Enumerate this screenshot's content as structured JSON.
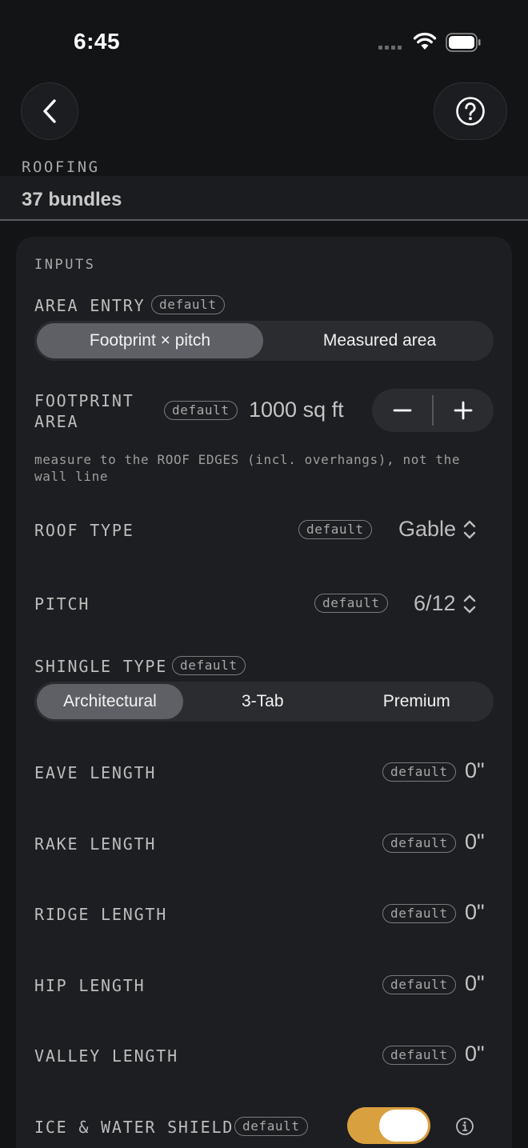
{
  "status": {
    "time": "6:45"
  },
  "header": {
    "section": "ROOFING",
    "result": "37 bundles"
  },
  "card": {
    "title": "INPUTS",
    "badge": "default",
    "area_entry": {
      "label": "AREA ENTRY",
      "options": [
        "Footprint × pitch",
        "Measured area"
      ],
      "selected": "Footprint × pitch"
    },
    "footprint_area": {
      "label_line1": "FOOTPRINT",
      "label_line2": "AREA",
      "value": "1000 sq ft",
      "hint": "measure to the ROOF EDGES (incl. overhangs), not the wall line"
    },
    "roof_type": {
      "label": "ROOF TYPE",
      "value": "Gable"
    },
    "pitch": {
      "label": "PITCH",
      "value": "6/12"
    },
    "shingle_type": {
      "label": "SHINGLE TYPE",
      "options": [
        "Architectural",
        "3-Tab",
        "Premium"
      ],
      "selected": "Architectural"
    },
    "lengths": [
      {
        "label": "EAVE LENGTH",
        "value": "0\""
      },
      {
        "label": "RAKE LENGTH",
        "value": "0\""
      },
      {
        "label": "RIDGE LENGTH",
        "value": "0\""
      },
      {
        "label": "HIP LENGTH",
        "value": "0\""
      },
      {
        "label": "VALLEY LENGTH",
        "value": "0\""
      }
    ],
    "ice_water_shield": {
      "label": "ICE & WATER SHIELD",
      "on": true
    }
  },
  "colors": {
    "accent": "#d9a03f",
    "background": "#131416",
    "card": "#1d1e21"
  }
}
